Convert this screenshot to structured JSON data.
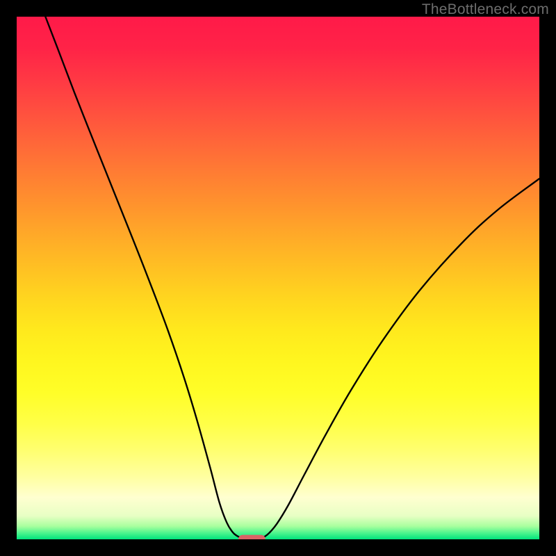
{
  "watermark": "TheBottleneck.com",
  "chart_data": {
    "type": "line",
    "title": "",
    "xlabel": "",
    "ylabel": "",
    "xlim": [
      0,
      100
    ],
    "ylim": [
      0,
      100
    ],
    "gradient_stops": [
      {
        "offset": 0.0,
        "color": "#ff1a49"
      },
      {
        "offset": 0.06,
        "color": "#ff2347"
      },
      {
        "offset": 0.12,
        "color": "#ff3844"
      },
      {
        "offset": 0.18,
        "color": "#ff4f3f"
      },
      {
        "offset": 0.24,
        "color": "#ff6639"
      },
      {
        "offset": 0.3,
        "color": "#ff7d33"
      },
      {
        "offset": 0.36,
        "color": "#ff932d"
      },
      {
        "offset": 0.42,
        "color": "#ffaa28"
      },
      {
        "offset": 0.48,
        "color": "#ffc023"
      },
      {
        "offset": 0.54,
        "color": "#ffd61f"
      },
      {
        "offset": 0.6,
        "color": "#ffe91d"
      },
      {
        "offset": 0.66,
        "color": "#fff61f"
      },
      {
        "offset": 0.72,
        "color": "#fffe28"
      },
      {
        "offset": 0.78,
        "color": "#ffff48"
      },
      {
        "offset": 0.83,
        "color": "#ffff70"
      },
      {
        "offset": 0.88,
        "color": "#ffffa0"
      },
      {
        "offset": 0.92,
        "color": "#ffffd0"
      },
      {
        "offset": 0.955,
        "color": "#e8ffc4"
      },
      {
        "offset": 0.975,
        "color": "#a8ff9e"
      },
      {
        "offset": 0.988,
        "color": "#4cf58d"
      },
      {
        "offset": 1.0,
        "color": "#00e37d"
      }
    ],
    "series": [
      {
        "name": "left-curve",
        "x": [
          5.5,
          8,
          11,
          14,
          17,
          20,
          23,
          26,
          29,
          32,
          34.5,
          37,
          38.8,
          40.2,
          41.3,
          42.1,
          42.8,
          43.2
        ],
        "y": [
          100,
          93.5,
          85.6,
          78.0,
          70.5,
          63.0,
          55.5,
          47.8,
          39.8,
          31.0,
          22.8,
          13.8,
          7.0,
          3.2,
          1.4,
          0.7,
          0.35,
          0.25
        ]
      },
      {
        "name": "right-curve",
        "x": [
          46.8,
          47.4,
          48.3,
          49.8,
          52,
          55,
          59,
          64,
          70,
          77,
          85,
          92,
          100
        ],
        "y": [
          0.25,
          0.5,
          1.2,
          3.0,
          6.6,
          12.3,
          19.8,
          28.6,
          38.0,
          47.5,
          56.5,
          63.0,
          69.0
        ]
      }
    ],
    "marker": {
      "name": "bottom-pill",
      "cx": 45.0,
      "cy": 0.0,
      "width": 5.2,
      "height": 1.7,
      "color": "#da6366"
    }
  }
}
